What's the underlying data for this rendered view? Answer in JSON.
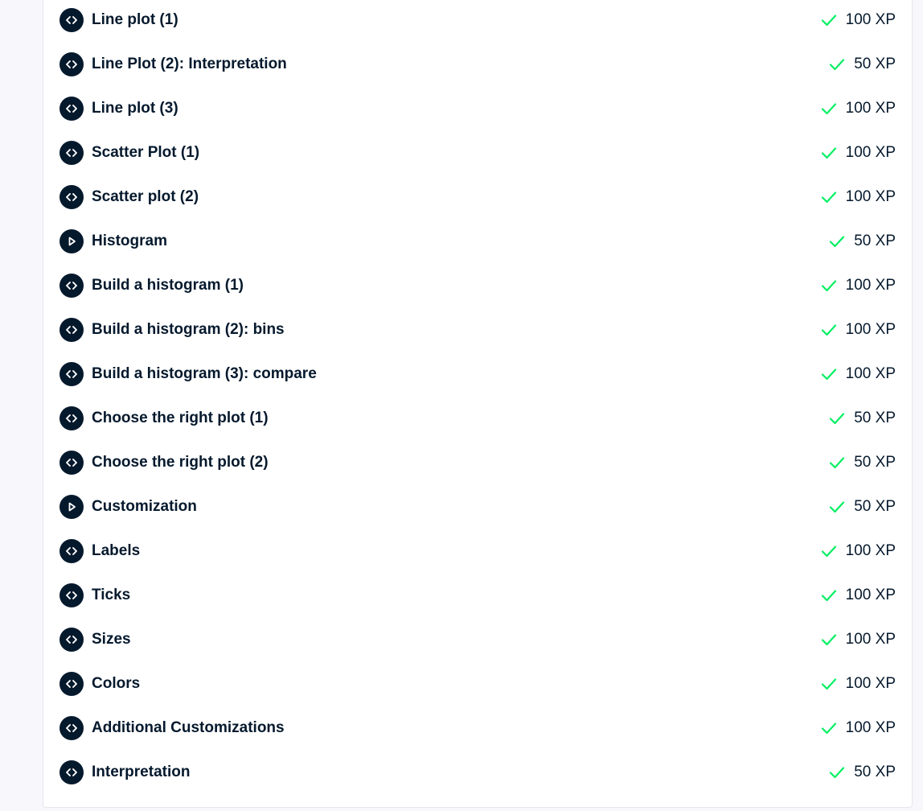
{
  "colors": {
    "page_background": "#f7f7fc",
    "panel_background": "#ffffff",
    "icon_background": "#05192d",
    "text": "#05192d",
    "check": "#03ef62"
  },
  "exercises": [
    {
      "title": "Line plot (1)",
      "type": "code",
      "icon": "code-icon",
      "completed": true,
      "xp": "100 XP"
    },
    {
      "title": "Line Plot (2): Interpretation",
      "type": "code",
      "icon": "code-icon",
      "completed": true,
      "xp": "50 XP"
    },
    {
      "title": "Line plot (3)",
      "type": "code",
      "icon": "code-icon",
      "completed": true,
      "xp": "100 XP"
    },
    {
      "title": "Scatter Plot (1)",
      "type": "code",
      "icon": "code-icon",
      "completed": true,
      "xp": "100 XP"
    },
    {
      "title": "Scatter plot (2)",
      "type": "code",
      "icon": "code-icon",
      "completed": true,
      "xp": "100 XP"
    },
    {
      "title": "Histogram",
      "type": "video",
      "icon": "play-icon",
      "completed": true,
      "xp": "50 XP"
    },
    {
      "title": "Build a histogram (1)",
      "type": "code",
      "icon": "code-icon",
      "completed": true,
      "xp": "100 XP"
    },
    {
      "title": "Build a histogram (2): bins",
      "type": "code",
      "icon": "code-icon",
      "completed": true,
      "xp": "100 XP"
    },
    {
      "title": "Build a histogram (3): compare",
      "type": "code",
      "icon": "code-icon",
      "completed": true,
      "xp": "100 XP"
    },
    {
      "title": "Choose the right plot (1)",
      "type": "code",
      "icon": "code-icon",
      "completed": true,
      "xp": "50 XP"
    },
    {
      "title": "Choose the right plot (2)",
      "type": "code",
      "icon": "code-icon",
      "completed": true,
      "xp": "50 XP"
    },
    {
      "title": "Customization",
      "type": "video",
      "icon": "play-icon",
      "completed": true,
      "xp": "50 XP"
    },
    {
      "title": "Labels",
      "type": "code",
      "icon": "code-icon",
      "completed": true,
      "xp": "100 XP"
    },
    {
      "title": "Ticks",
      "type": "code",
      "icon": "code-icon",
      "completed": true,
      "xp": "100 XP"
    },
    {
      "title": "Sizes",
      "type": "code",
      "icon": "code-icon",
      "completed": true,
      "xp": "100 XP"
    },
    {
      "title": "Colors",
      "type": "code",
      "icon": "code-icon",
      "completed": true,
      "xp": "100 XP"
    },
    {
      "title": "Additional Customizations",
      "type": "code",
      "icon": "code-icon",
      "completed": true,
      "xp": "100 XP"
    },
    {
      "title": "Interpretation",
      "type": "code",
      "icon": "code-icon",
      "completed": true,
      "xp": "50 XP"
    }
  ]
}
